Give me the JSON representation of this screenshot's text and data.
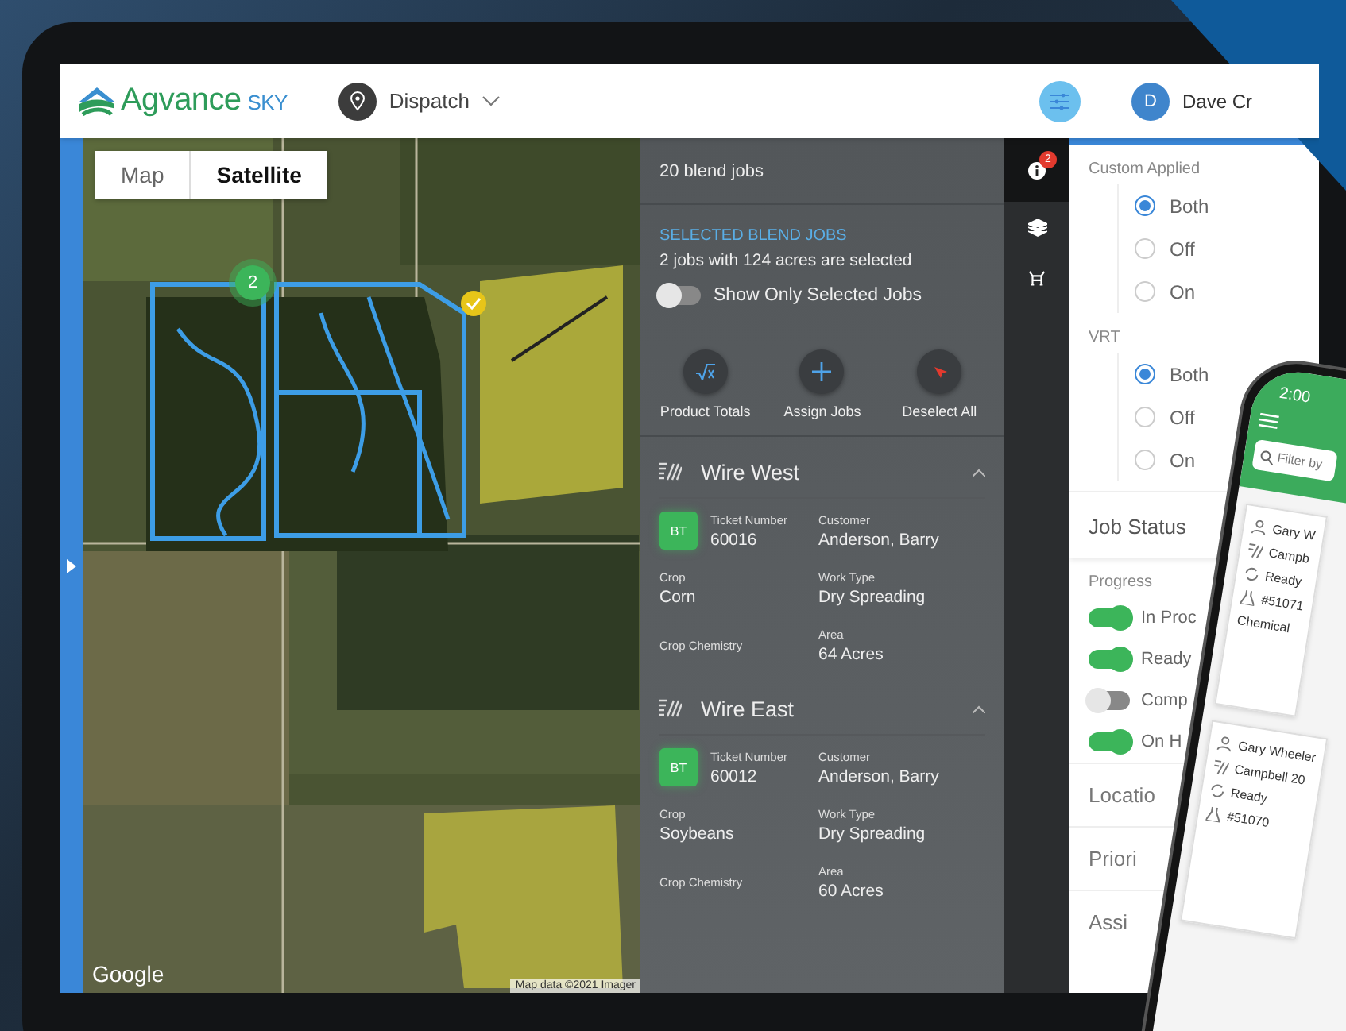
{
  "header": {
    "logo": {
      "name": "Agvance",
      "suffix": "SKY"
    },
    "module": "Dispatch",
    "user": {
      "initial": "D",
      "name": "Dave Cr"
    }
  },
  "map": {
    "tabs": [
      {
        "label": "Map",
        "selected": false
      },
      {
        "label": "Satellite",
        "selected": true
      }
    ],
    "cluster": "2",
    "attribution": "Google",
    "credit": "Map data ©2021 Imager"
  },
  "jobs_panel": {
    "count": "20 blend jobs",
    "selected_heading": "SELECTED BLEND JOBS",
    "selected_summary": "2 jobs with 124 acres are selected",
    "toggle": {
      "label": "Show Only Selected Jobs",
      "on": false
    },
    "actions": [
      {
        "kind": "sqrt",
        "label": "Product Totals"
      },
      {
        "kind": "plus",
        "label": "Assign Jobs"
      },
      {
        "kind": "deselect",
        "label": "Deselect All"
      }
    ],
    "jobs": [
      {
        "name": "Wire West",
        "badge": "BT",
        "fields": [
          {
            "label": "Ticket Number",
            "value": "60016"
          },
          {
            "label": "Customer",
            "value": "Anderson, Barry"
          },
          {
            "label": "Crop",
            "value": "Corn"
          },
          {
            "label": "Work Type",
            "value": "Dry Spreading"
          },
          {
            "label": "Crop Chemistry"
          },
          {
            "label": "Area",
            "value": "64 Acres"
          }
        ]
      },
      {
        "name": "Wire East",
        "badge": "BT",
        "fields": [
          {
            "label": "Ticket Number",
            "value": "60012"
          },
          {
            "label": "Customer",
            "value": "Anderson, Barry"
          },
          {
            "label": "Crop",
            "value": "Soybeans"
          },
          {
            "label": "Work Type",
            "value": "Dry Spreading"
          },
          {
            "label": "Crop Chemistry"
          },
          {
            "label": "Area",
            "value": "60 Acres"
          }
        ]
      }
    ]
  },
  "side_icons": [
    {
      "kind": "info",
      "badge": "2",
      "selected": true
    },
    {
      "kind": "layers",
      "selected": false
    },
    {
      "kind": "vehicle",
      "selected": false
    }
  ],
  "filters": {
    "groups": [
      {
        "label": "Custom Applied",
        "options": [
          {
            "label": "Both",
            "selected": true
          },
          {
            "label": "Off",
            "selected": false
          },
          {
            "label": "On",
            "selected": false
          }
        ]
      },
      {
        "label": "VRT",
        "options": [
          {
            "label": "Both",
            "selected": true
          },
          {
            "label": "Off",
            "selected": false
          },
          {
            "label": "On",
            "selected": false
          }
        ]
      }
    ],
    "job_status": "Job Status",
    "progress": {
      "label": "Progress",
      "items": [
        {
          "label": "In Proc",
          "on": true
        },
        {
          "label": "Ready",
          "on": true
        },
        {
          "label": "Comp",
          "on": false
        },
        {
          "label": "On H",
          "on": true
        }
      ]
    },
    "sections": [
      "Locatio",
      "Priori",
      "Assi"
    ]
  },
  "phone": {
    "time": "2:00",
    "search_placeholder": "Filter by",
    "cards": [
      {
        "person": "Gary W",
        "field": "Campb",
        "status": "Ready",
        "ticket": "#51071",
        "note": "Chemical"
      },
      {
        "person": "Gary Wheeler",
        "field": "Campbell 20",
        "status": "Ready",
        "ticket": "#51070"
      }
    ]
  }
}
